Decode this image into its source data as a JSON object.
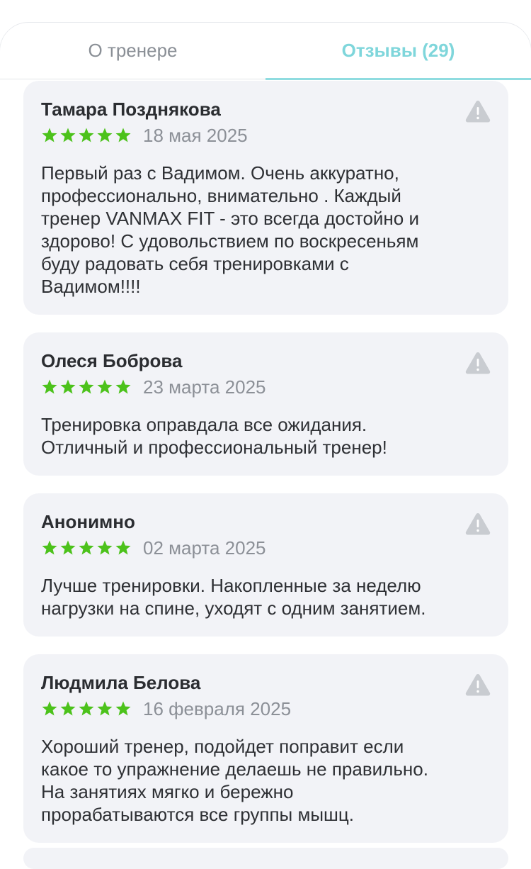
{
  "tabs": {
    "about_label": "О тренере",
    "reviews_label": "Отзывы (29)",
    "active": "reviews"
  },
  "colors": {
    "accent": "#7fd6db",
    "star": "#4cc21b",
    "card_bg": "#f2f3f7",
    "warn_icon": "#c9ccd1"
  },
  "reviews": [
    {
      "author": "Тамара Позднякова",
      "rating": 5,
      "date": "18 мая 2025",
      "text": "Первый раз с Вадимом. Очень аккуратно,\nпрофессионально, внимательно . Каждый\nтренер VANMAX FIT - это всегда достойно и\nздорово! С удовольствием по воскресеньям\nбуду радовать себя тренировками с\nВадимом!!!!",
      "icon": "warning-triangle-icon"
    },
    {
      "author": "Олеся Боброва",
      "rating": 5,
      "date": "23 марта 2025",
      "text": "Тренировка оправдала все ожидания.\nОтличный и профессиональный тренер!",
      "icon": "warning-triangle-icon"
    },
    {
      "author": "Анонимно",
      "rating": 5,
      "date": "02 марта 2025",
      "text": "Лучше тренировки. Накопленные за неделю\nнагрузки на спине,  уходят с одним занятием.",
      "icon": "warning-triangle-icon"
    },
    {
      "author": "Людмила Белова",
      "rating": 5,
      "date": "16 февраля 2025",
      "text": "Хороший тренер, подойдет поправит если\nкакое то упражнение делаешь не правильно.\nНа занятиях мягко и бережно\nпрорабатываются все группы мышц.",
      "icon": "warning-triangle-icon"
    }
  ]
}
